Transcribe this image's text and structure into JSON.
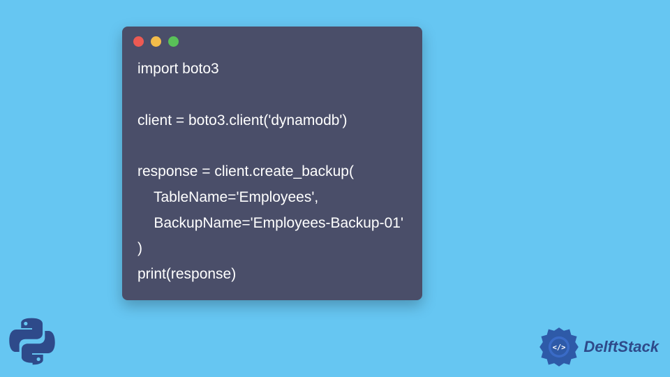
{
  "code": {
    "lines": [
      "import boto3",
      "",
      "client = boto3.client('dynamodb')",
      "",
      "response = client.create_backup(",
      "    TableName='Employees',",
      "    BackupName='Employees-Backup-01'",
      ")",
      "print(response)"
    ]
  },
  "brand": {
    "name": "DelftStack"
  },
  "colors": {
    "background": "#66c6f2",
    "code_window": "#4a4e69",
    "text": "#ffffff",
    "dot_red": "#ec5a53",
    "dot_yellow": "#f3bc4a",
    "dot_green": "#59c158",
    "brand_text": "#2e4a8a"
  }
}
